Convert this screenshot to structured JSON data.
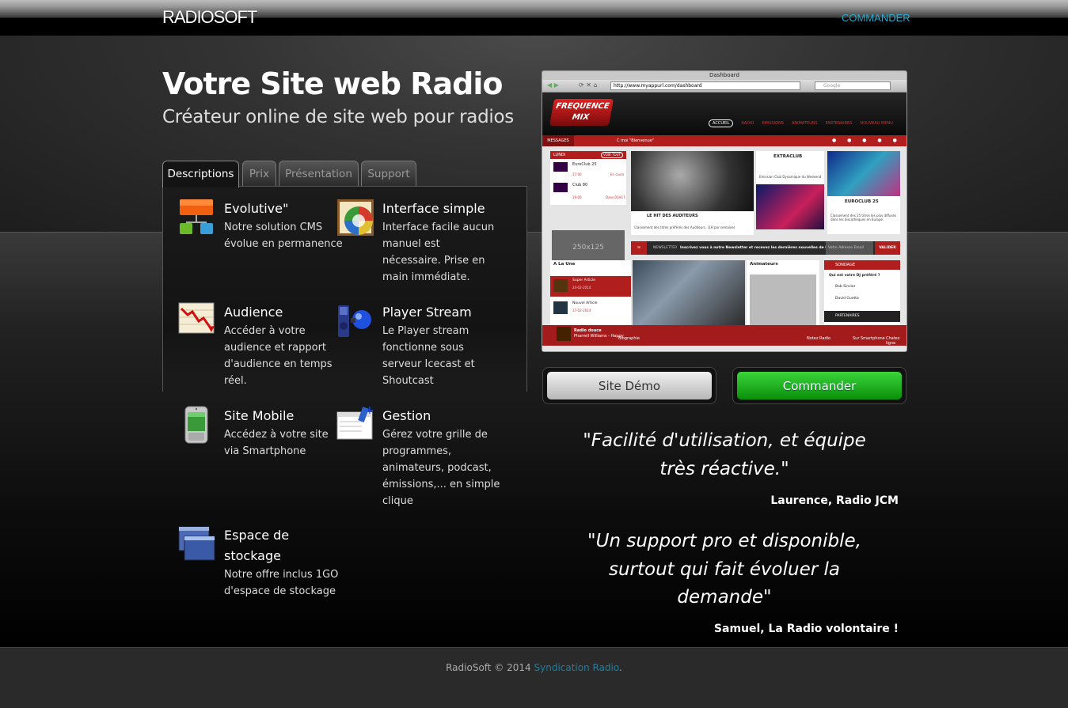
{
  "header": {
    "logo": "RADIOSOFT",
    "order_link": "COMMANDER"
  },
  "hero": {
    "title": "Votre Site web Radio",
    "subtitle": "Créateur online de site web pour radios"
  },
  "tabs": [
    {
      "label": "Descriptions",
      "active": true
    },
    {
      "label": "Prix",
      "active": false
    },
    {
      "label": "Présentation",
      "active": false
    },
    {
      "label": "Support",
      "active": false
    }
  ],
  "features": [
    {
      "icon": "cms-blocks-icon",
      "title": "Evolutive\"",
      "text": "Notre solution CMS évolue en permanence"
    },
    {
      "icon": "color-palette-icon",
      "title": "Interface simple",
      "text": "Interface facile aucun manuel est nécessaire. Prise en main immédiate."
    },
    {
      "icon": "audience-chart-icon",
      "title": "Audience",
      "text": "Accéder à votre audience et rapport d'audience en temps réel."
    },
    {
      "icon": "speaker-stream-icon",
      "title": "Player Stream",
      "text": "Le Player stream fonctionne sous serveur Icecast et Shoutcast"
    },
    {
      "icon": "smartphone-icon",
      "title": "Site Mobile",
      "text": "Accédez à votre site via Smartphone"
    },
    {
      "icon": "schedule-edit-icon",
      "title": "Gestion",
      "text": "Gérez votre grille de programmes, animateurs, podcast, émissions,... en simple clique"
    },
    {
      "icon": "storage-windows-icon",
      "title": "Espace de stockage",
      "text": "Notre offre inclus 1GO d'espace de stockage"
    }
  ],
  "browser": {
    "window_title": "Dashboard",
    "url": "http://www.myappurl.com/dashboard",
    "search_placeholder": "Google",
    "site": {
      "logo": "FREQUENCE MIX",
      "nav": [
        "ACCUEIL",
        "RADIO",
        "EMISSIONS",
        "ANIMATEURS",
        "PARTENAIRES",
        "NOUVEAU MENU"
      ],
      "messages_label": "MESSAGES",
      "message_text": "C moi \"Bienvenue\"",
      "day_label": "LUNDI",
      "see_all": "VOIR TOUT",
      "schedule": [
        {
          "name": "EuroClub 25",
          "time": "17:00",
          "status": "En cours"
        },
        {
          "name": "Club 80",
          "time": "19:00",
          "status": "Dans 01H17"
        }
      ],
      "ad": "250x125",
      "cards": [
        {
          "title": "LE HIT DES AUDITEURS",
          "text": "Classement des titres préférés des Auditeurs. (1H par semaine)"
        },
        {
          "title": "EXTRACLUB",
          "text": "Emission Club Dynamique du Weekend"
        },
        {
          "title": "EUROCLUB 25",
          "text": "Classement des 25 titres les plus diffusés dans les discothèques en Europe."
        }
      ],
      "newsletter_label": "NEWSLETTER",
      "newsletter_text": "Inscrivez vous à notre Newsletter et recevez les dernières nouvelles de la radio !",
      "newsletter_placeholder": "Votre Adresse Email",
      "newsletter_button": "VALIDER",
      "a_la_une": "A La Une",
      "articles": [
        {
          "title": "Super Article",
          "date": "24-02-2014"
        },
        {
          "title": "Nouvel Article",
          "date": "17-02-2014"
        }
      ],
      "animateurs_label": "Animateurs",
      "poll_label": "SONDAGE",
      "poll_question": "Qui est votre DJ préféré ?",
      "poll_options": [
        "Bob Sinclar",
        "David Guetta"
      ],
      "partners_label": "PARTENAIRES",
      "player_title": "Radio douce",
      "player_track": "Pharrell Williams - Happy",
      "bottom_links": [
        "Biographie",
        "Notez Radio",
        "Sur Smartphone",
        "Chatez ligne"
      ]
    }
  },
  "buttons": {
    "demo": "Site Démo",
    "order": "Commander"
  },
  "testimonials": [
    {
      "quote": "\"Facilité d'utilisation, et équipe très réactive.\"",
      "author": "Laurence, Radio JCM"
    },
    {
      "quote": "\"Un support pro et disponible, surtout qui fait évoluer la demande\"",
      "author": "Samuel, La Radio volontaire !"
    }
  ],
  "footer": {
    "prefix": "RadioSoft © 2014 ",
    "link": "Syndication Radio",
    "suffix": "."
  }
}
